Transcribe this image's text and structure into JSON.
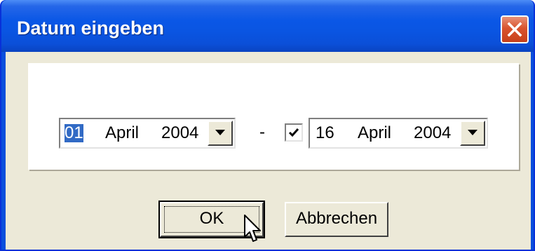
{
  "window": {
    "title": "Datum eingeben",
    "close_icon": "close-icon"
  },
  "colors": {
    "titlebar": "#0a57e6",
    "client": "#ece9d8",
    "selection": "#316ac5",
    "close_button": "#d9532e"
  },
  "date_from": {
    "day": "01",
    "month": "April",
    "year": "2004",
    "day_selected": true,
    "dropdown_icon": "chevron-down-icon"
  },
  "separator": "-",
  "range_enabled": {
    "checked": true,
    "icon": "checkmark-icon"
  },
  "date_to": {
    "day": "16",
    "month": "April",
    "year": "2004",
    "dropdown_icon": "chevron-down-icon"
  },
  "buttons": {
    "ok_label": "OK",
    "cancel_label": "Abbrechen"
  },
  "cursor": {
    "icon": "mouse-pointer-icon"
  }
}
